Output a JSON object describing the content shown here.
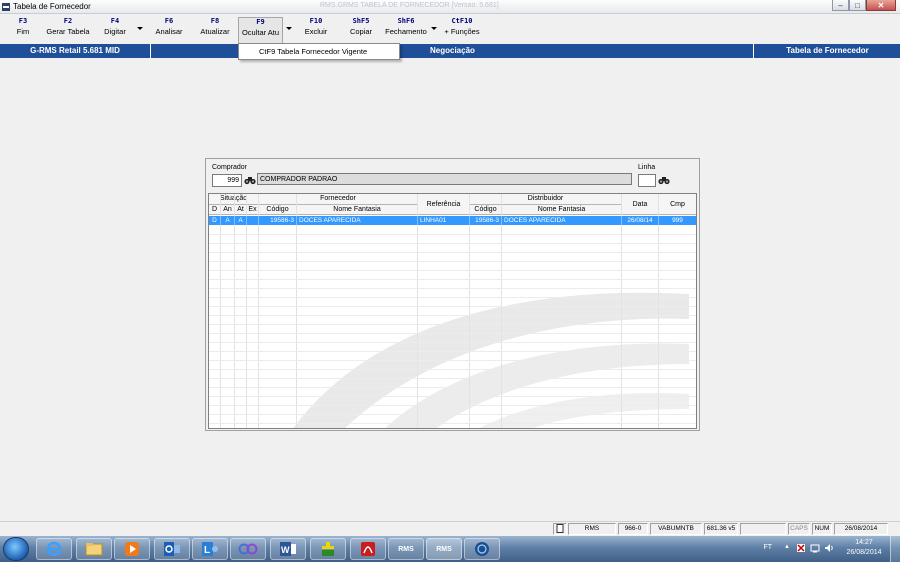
{
  "window": {
    "title": "Tabela de Fornecedor",
    "ghost_title": "RMS.GRMS TABELA DE FORNECEDOR [Versao: 5.681]",
    "minimize": "–",
    "maximize": "□",
    "close": "✕"
  },
  "toolbar": {
    "keys": [
      {
        "key": "F3",
        "label": "Fim"
      },
      {
        "key": "F2",
        "label": "Gerar Tabela"
      },
      {
        "key": "F4",
        "label": "Digitar"
      },
      {
        "key": "F6",
        "label": "Analisar"
      },
      {
        "key": "F8",
        "label": "Atualizar"
      },
      {
        "key": "F9",
        "label": "Ocultar Atu"
      },
      {
        "key": "F10",
        "label": "Excluir"
      },
      {
        "key": "ShF5",
        "label": "Copiar"
      },
      {
        "key": "ShF6",
        "label": "Fechamento"
      },
      {
        "key": "CtF10",
        "label": "+ Funções"
      }
    ]
  },
  "infobar": {
    "system": "G-RMS Retail 5.681 MID",
    "module": "Negociação",
    "screen": "Tabela de Fornecedor"
  },
  "dropdown": {
    "item": "CtF9  Tabela Fornecedor Vigente"
  },
  "form": {
    "comprador_label": "Comprador",
    "comprador_code": "999",
    "comprador_name": "COMPRADOR PADRAO",
    "linha_label": "Linha",
    "linha_value": ""
  },
  "grid": {
    "group_headers": {
      "situacao": "Situação",
      "fornecedor": "Fornecedor",
      "referencia": "Referência",
      "distribuidor": "Distribuidor",
      "data": "Data",
      "cmp": "Cmp"
    },
    "sub_headers": {
      "d": "D",
      "an": "An",
      "at": "At",
      "ex": "Ex",
      "forn_codigo": "Código",
      "forn_nome": "Nome Fantasia",
      "dist_codigo": "Código",
      "dist_nome": "Nome Fantasia"
    },
    "rows": [
      {
        "d": "D",
        "an": "A",
        "at": "A",
        "ex": "",
        "forn_codigo": "19586-3",
        "forn_nome": "DOCES APARECIDA",
        "referencia": "LINHA01",
        "dist_codigo": "19586-3",
        "dist_nome": "DOCES APARECIDA",
        "data": "26/08/14",
        "cmp": "999"
      }
    ]
  },
  "statusbar": {
    "app": "RMS",
    "code": "966-0",
    "user": "VABUMNTB",
    "version": "681.36 v5",
    "caps": "CAPS",
    "num": "NUM",
    "date": "26/08/2014"
  },
  "taskbar": {
    "rms_label_1": "RMS",
    "rms_label_2": "RMS",
    "lang": "FT",
    "clock_time": "14:27",
    "clock_date": "26/08/2014"
  },
  "colors": {
    "infobar_bg": "#1f4f99",
    "selection": "#3399ff",
    "key_text": "#00007a"
  }
}
